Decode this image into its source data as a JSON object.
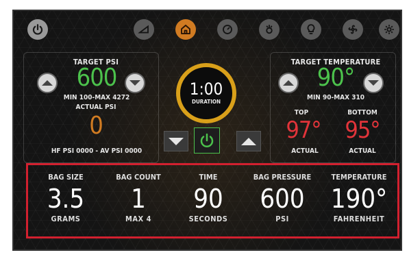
{
  "top_icons": [
    {
      "name": "power"
    },
    {
      "name": "slider"
    },
    {
      "name": "home"
    },
    {
      "name": "gauge"
    },
    {
      "name": "temperature"
    },
    {
      "name": "bulb"
    },
    {
      "name": "fan"
    },
    {
      "name": "settings"
    }
  ],
  "left_panel": {
    "target_label": "TARGET PSI",
    "target_value": "600",
    "target_range": "MIN 100-MAX 4272",
    "actual_label": "ACTUAL PSI",
    "actual_value": "0",
    "footer": "HF PSI 0000 - AV PSI 0000"
  },
  "center": {
    "time": "1:00",
    "time_label": "DURATION"
  },
  "right_panel": {
    "target_label": "TARGET TEMPERATURE",
    "target_value": "90°",
    "target_range": "MIN 90-MAX 310",
    "top_label": "TOP",
    "top_value": "97°",
    "top_sub": "ACTUAL",
    "bottom_label": "BOTTOM",
    "bottom_value": "95°",
    "bottom_sub": "ACTUAL"
  },
  "stats": [
    {
      "label": "BAG SIZE",
      "value": "3.5",
      "unit": "GRAMS"
    },
    {
      "label": "BAG COUNT",
      "value": "1",
      "unit": "MAX 4"
    },
    {
      "label": "TIME",
      "value": "90",
      "unit": "SECONDS"
    },
    {
      "label": "BAG PRESSURE",
      "value": "600",
      "unit": "PSI"
    },
    {
      "label": "TEMPERATURE",
      "value": "190°",
      "unit": "FAHRENHEIT"
    }
  ],
  "colors": {
    "accent_orange": "#d07b22",
    "green": "#4cc24c",
    "red": "#e2343a",
    "highlight_box": "#d2202f"
  }
}
